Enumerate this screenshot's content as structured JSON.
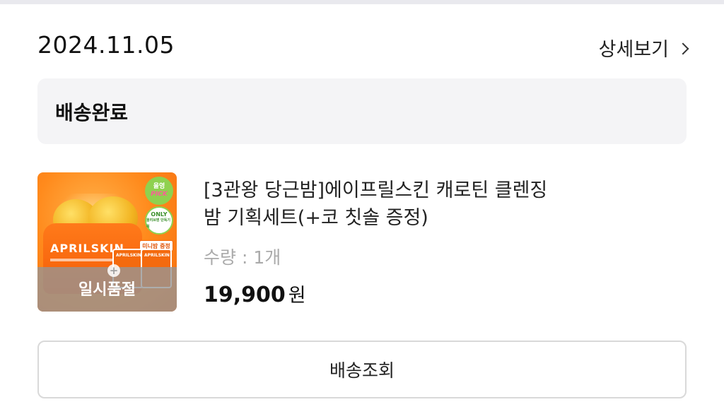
{
  "order": {
    "date": "2024.11.05",
    "detail_link": "상세보기",
    "status": "배송완료"
  },
  "product": {
    "name_line1": "[3관왕 당근밤]에이프릴스킨 캐로틴 클렌징",
    "name_line2": "밤 기획세트(+코 칫솔 증정)",
    "quantity": "수량 : 1개",
    "price": "19,900",
    "price_unit": "원",
    "thumbnail": {
      "brand": "APRILSKIN",
      "badge_pick_top": "올영",
      "badge_pick_bottom": "PICK",
      "badge_only_top": "ONLY",
      "badge_only_bottom": "올리브영 단독기획",
      "mini_tag": "미니밤 증정",
      "mini_box_brand": "APRILSKIN",
      "soldout_label": "일시품절",
      "plus": "+"
    }
  },
  "actions": {
    "track_delivery": "배송조회"
  },
  "colors": {
    "accent_orange": "#f46a0e",
    "status_bg": "#f4f4f6",
    "muted_text": "#aaaaaa"
  },
  "icons": {
    "detail_chevron": "chevron-right-icon"
  }
}
